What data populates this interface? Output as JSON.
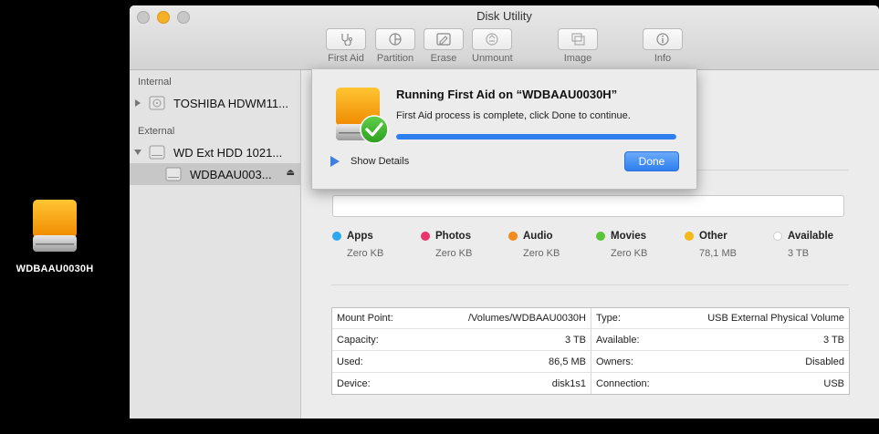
{
  "desktop": {
    "icon_label": "WDBAAU0030H"
  },
  "window": {
    "title": "Disk Utility"
  },
  "toolbar": {
    "first_aid": "First Aid",
    "partition": "Partition",
    "erase": "Erase",
    "unmount": "Unmount",
    "image": "Image",
    "info": "Info"
  },
  "sidebar": {
    "internal_header": "Internal",
    "external_header": "External",
    "internal_disk": "TOSHIBA HDWM11...",
    "external_disk": "WD Ext HDD 1021...",
    "external_volume": "WDBAAU003..."
  },
  "sheet": {
    "title": "Running First Aid on “WDBAAU0030H”",
    "subtitle": "First Aid process is complete, click Done to continue.",
    "show_details": "Show Details",
    "done": "Done",
    "progress": 1.0
  },
  "legend": [
    {
      "name": "Apps",
      "value": "Zero KB",
      "color": "#2fa8ee"
    },
    {
      "name": "Photos",
      "value": "Zero KB",
      "color": "#e8336e"
    },
    {
      "name": "Audio",
      "value": "Zero KB",
      "color": "#f28a1c"
    },
    {
      "name": "Movies",
      "value": "Zero KB",
      "color": "#59c63a"
    },
    {
      "name": "Other",
      "value": "78,1 MB",
      "color": "#f4b819"
    },
    {
      "name": "Available",
      "value": "3 TB",
      "color": "#ffffff"
    }
  ],
  "info": {
    "mount_point": {
      "label": "Mount Point:",
      "value": "/Volumes/WDBAAU0030H"
    },
    "capacity": {
      "label": "Capacity:",
      "value": "3 TB"
    },
    "used": {
      "label": "Used:",
      "value": "86,5 MB"
    },
    "device": {
      "label": "Device:",
      "value": "disk1s1"
    },
    "type": {
      "label": "Type:",
      "value": "USB External Physical Volume"
    },
    "available": {
      "label": "Available:",
      "value": "3 TB"
    },
    "owners": {
      "label": "Owners:",
      "value": "Disabled"
    },
    "connection": {
      "label": "Connection:",
      "value": "USB"
    }
  },
  "colors": {
    "accent": "#2f7ef0",
    "drive_orange": "#f5a623"
  }
}
